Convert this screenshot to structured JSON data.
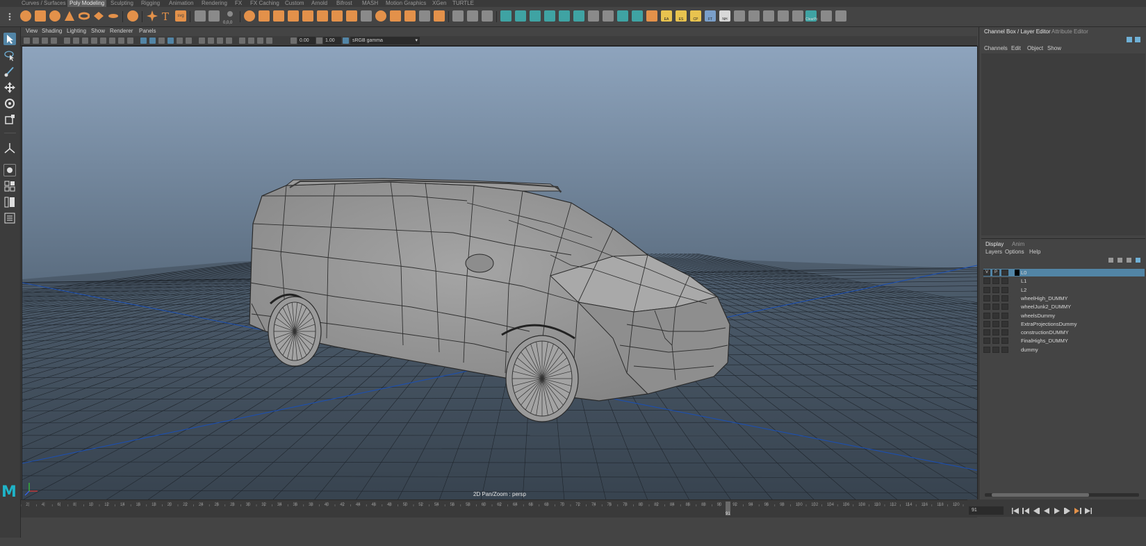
{
  "shelf": {
    "tabs": [
      "Curves / Surfaces",
      "Poly Modeling",
      "Sculpting",
      "Rigging",
      "Animation",
      "Rendering",
      "FX",
      "FX Caching",
      "Custom",
      "Arnold",
      "Bifrost",
      "MASH",
      "Motion Graphics",
      "XGen",
      "TURTLE"
    ],
    "active_tab": "Poly Modeling",
    "icon_labels": {
      "svg": "svg",
      "ea": "EA",
      "es": "ES",
      "cp": "CP",
      "ft": "FT",
      "nh": "NH",
      "clearpc": "ClearPc"
    },
    "coord_label": "0,0,0"
  },
  "viewport": {
    "menu": [
      "View",
      "Shading",
      "Lighting",
      "Show",
      "Renderer",
      "Panels"
    ],
    "exposure": "0.00",
    "gamma": "1.00",
    "color_space": "sRGB gamma",
    "camera_label": "2D Pan/Zoom : persp"
  },
  "right_panel": {
    "tabs": [
      "Channel Box / Layer Editor",
      "Attribute Editor"
    ],
    "channel_menu": [
      "Channels",
      "Edit",
      "Object",
      "Show"
    ],
    "layer_tabs": [
      "Display",
      "Anim"
    ],
    "layer_menu": [
      "Layers",
      "Options",
      "Help"
    ],
    "layers": [
      {
        "name": "L0",
        "v": "V",
        "p": "P",
        "selected": true,
        "color": "#000000"
      },
      {
        "name": "L1",
        "v": "",
        "p": "",
        "selected": false,
        "color": ""
      },
      {
        "name": "L2",
        "v": "",
        "p": "",
        "selected": false,
        "color": ""
      },
      {
        "name": "wheelHigh_DUMMY",
        "v": "",
        "p": "",
        "selected": false,
        "color": ""
      },
      {
        "name": "wheelJunk2_DUMMY",
        "v": "",
        "p": "",
        "selected": false,
        "color": ""
      },
      {
        "name": "wheelsDummy",
        "v": "",
        "p": "",
        "selected": false,
        "color": ""
      },
      {
        "name": "ExtraProjectionsDummy",
        "v": "",
        "p": "",
        "selected": false,
        "color": ""
      },
      {
        "name": "constructionDUMMY",
        "v": "",
        "p": "",
        "selected": false,
        "color": ""
      },
      {
        "name": "FinalHighs_DUMMY",
        "v": "",
        "p": "",
        "selected": false,
        "color": ""
      },
      {
        "name": "dummy",
        "v": "",
        "p": "",
        "selected": false,
        "color": ""
      }
    ]
  },
  "timeline": {
    "ticks": [
      "2",
      "4",
      "6",
      "8",
      "10",
      "12",
      "14",
      "16",
      "18",
      "20",
      "22",
      "24",
      "26",
      "28",
      "30",
      "32",
      "34",
      "36",
      "38",
      "40",
      "42",
      "44",
      "46",
      "48",
      "50",
      "52",
      "54",
      "56",
      "58",
      "60",
      "62",
      "64",
      "66",
      "68",
      "70",
      "72",
      "74",
      "76",
      "78",
      "80",
      "82",
      "84",
      "86",
      "88",
      "90",
      "92",
      "94",
      "96",
      "98",
      "100",
      "102",
      "104",
      "106",
      "108",
      "110",
      "112",
      "114",
      "116",
      "118",
      "120"
    ],
    "current_frame": "91",
    "current_frame_field": "91"
  },
  "colors": {
    "accent_orange": "#e3914a",
    "maya_logo": "#1fb3c7",
    "selection_blue": "#5285a6",
    "viewport_sky_top": "#8ea4bd",
    "viewport_sky_bottom": "#3d4a57",
    "grid_axis_blue": "#1c4fb0"
  }
}
